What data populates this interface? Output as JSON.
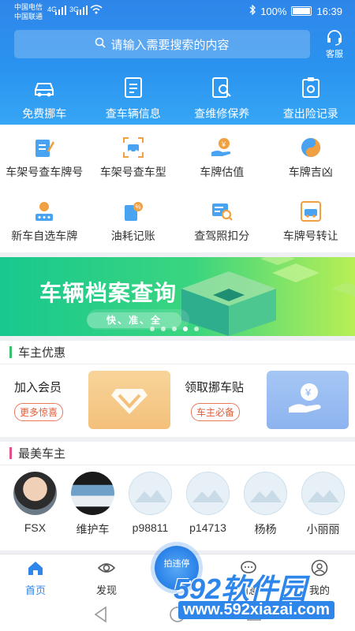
{
  "status": {
    "carrier1": "中国电信",
    "carrier2": "中国联通",
    "sig1": "4G",
    "sig2": "3G",
    "battery": "100%",
    "time": "16:39"
  },
  "search": {
    "placeholder": "请输入需要搜索的内容"
  },
  "service": {
    "label": "客服"
  },
  "topnav": [
    "免费挪车",
    "查车辆信息",
    "查维修保养",
    "查出险记录"
  ],
  "grid": {
    "row1": [
      "车架号查车牌号",
      "车架号查车型",
      "车牌估值",
      "车牌吉凶"
    ],
    "row2": [
      "新车自选车牌",
      "油耗记账",
      "查驾照扣分",
      "车牌号转让"
    ]
  },
  "banner": {
    "title": "车辆档案查询",
    "subtitle": "快、准、全"
  },
  "offers": {
    "heading": "车主优惠",
    "item1_title": "加入会员",
    "item1_btn": "更多惊喜",
    "item2_title": "领取挪车贴",
    "item2_btn": "车主必备"
  },
  "owners": {
    "heading": "最美车主",
    "names": [
      "FSX",
      "维护车",
      "p98811",
      "p14713",
      "杨杨",
      "小丽丽"
    ]
  },
  "tabs": {
    "home": "首页",
    "discover": "发现",
    "shoot": "拍违停",
    "messages": "消息",
    "mine": "我的"
  },
  "watermark": {
    "big": "592软件园",
    "url": "www.592xiazai.com"
  },
  "colors": {
    "primary": "#2f86ea",
    "green_bar": "#3bbf6a",
    "pink_bar": "#e0508a",
    "promo_orange": "#f5c98a",
    "promo_blue": "#93b9f2"
  }
}
